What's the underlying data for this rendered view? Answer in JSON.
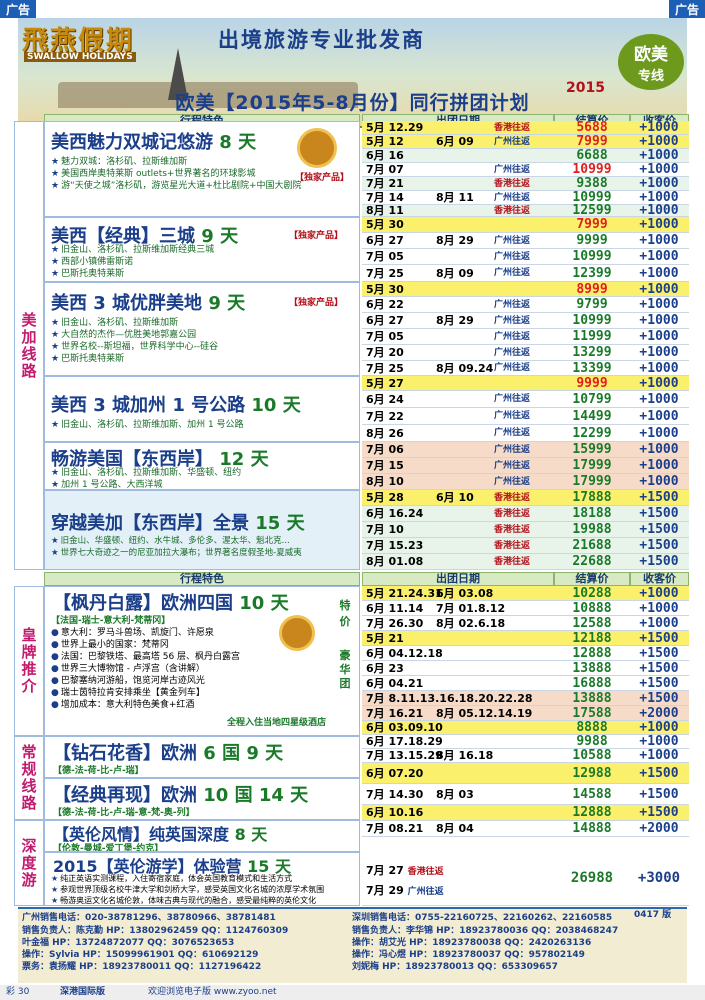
{
  "ad_label_left": "广告",
  "ad_label_right": "广告",
  "banner": {
    "logo_cn": "飛燕假期",
    "logo_en": "SWALLOW HOLIDAYS",
    "slogan": "出境旅游专业批发商",
    "badge_line1": "欧美",
    "badge_line2": "专线",
    "year": "2015",
    "main_title": "欧美【2015年5-8月份】同行拼团计划"
  },
  "headers": {
    "features": "行程特色",
    "dates": "出团日期",
    "settle": "结算价",
    "commission": "收客价"
  },
  "categories": {
    "us": "美加线路",
    "royal": "皇牌推介",
    "regular": "常规线路",
    "deep": "深度游"
  },
  "products": [
    {
      "title": "美西魅力双城记悠游",
      "days": "8 天",
      "excl": "【独家产品】",
      "features": [
        "魅力双城：洛杉矶、拉斯维加斯",
        "美国西岸奥特莱斯 outlets+世界著名的环球影城",
        "游“天使之城”洛杉矶，游览星光大道+杜比剧院+中国大剧院"
      ]
    },
    {
      "title": "美西【经典】三城",
      "days": "9 天",
      "excl": "【独家产品】",
      "features": [
        "旧金山、洛杉矶、拉斯维加斯经典三城",
        "西部小镇佛雷斯诺",
        "巴斯托奥特莱斯"
      ]
    },
    {
      "title": "美西 3 城优胖美地",
      "days": "9 天",
      "excl": "【独家产品】",
      "features": [
        "旧金山、洛杉矶、拉斯维加斯",
        "大自然的杰作—优胜美地郭嘉公园",
        "世界名校--斯坦福，世界科学中心--硅谷",
        "巴斯托奥特莱斯"
      ]
    },
    {
      "title": "美西 3 城加州 1 号公路",
      "days": "10 天",
      "excl": "",
      "features": [
        "旧金山、洛杉矶、拉斯维加斯、加州 1 号公路"
      ]
    },
    {
      "title": "畅游美国【东西岸】",
      "days": "12 天",
      "excl": "",
      "features": [
        "旧金山、洛杉矶、拉斯维加斯、华盛顿、纽约",
        "加州 1 号公路、大西洋城"
      ]
    },
    {
      "title": "穿越美加【东西岸】全景",
      "days": "15 天",
      "excl": "",
      "features": [
        "旧金山、华盛顿、纽约、水牛城、多伦多、渥太华、魁北克...",
        "世界七大奇迹之一的尼亚加拉大瀑布；世界著名度假圣地-夏威夷"
      ]
    },
    {
      "title": "【枫丹白露】欧洲四国",
      "days": "10 天",
      "sub": "【法国-瑞士-意大利-梵蒂冈】",
      "side1": "特价",
      "side2": "豪华团",
      "features": [
        "意大利：罗马斗兽场、凯旋门、许愿泉",
        "世界上最小的国家：梵蒂冈",
        "法国：巴黎铁塔、最高塔 56 层、枫丹白露宫",
        "世界三大博物馆 - 卢浮宫（含讲解）",
        "巴黎塞纳河游船，饱览河岸古迹风光",
        "瑞士茵特拉肯安排乘坐【黄金列车】",
        "增加成本：意大利特色美食+红酒"
      ],
      "note": "全程入住当地四星级酒店"
    },
    {
      "title": "【钻石花香】欧洲",
      "days": "6 国 9 天",
      "sub": "【德-法-荷-比-卢-瑞】"
    },
    {
      "title": "【经典再现】欧洲",
      "days": "10 国 14 天",
      "sub": "【德-法-荷-比-卢-瑞-意-梵-奥-列】"
    },
    {
      "title": "【英伦风情】纯英国深度",
      "days": "8 天",
      "sub": "【伦敦-曼城-爱丁堡-约克】"
    },
    {
      "title": "2015【英伦游学】体验营",
      "days": "15 天",
      "features": [
        "纯正英语实测课程，入住寄宿家庭，体会英国教育模式和生活方式",
        "参观世界顶级名校牛津大学和剑桥大学，感受英国文化名城的浓厚学术氛围",
        "畅游奥运文化名城伦敦，体味古典与现代的融合，感受最纯粹的英伦文化"
      ]
    }
  ],
  "rows": [
    {
      "d1": "5月 12.29",
      "d2": "",
      "tag": "香港往返",
      "price": "5688",
      "comm": "+1000",
      "bg": "y",
      "red": true
    },
    {
      "d1": "5月 12",
      "d2": "6月 09",
      "tag": "广州往返",
      "price": "7999",
      "comm": "+1000",
      "bg": "y",
      "red": true
    },
    {
      "d1": "6月 16",
      "d2": "",
      "tag": "",
      "price": "6688",
      "comm": "+1000",
      "bg": "g"
    },
    {
      "d1": "7月 07",
      "d2": "",
      "tag": "广州往返",
      "price": "10999",
      "comm": "+1000",
      "bg": "w",
      "red": true
    },
    {
      "d1": "7月 21",
      "d2": "",
      "tag": "香港往返",
      "price": "9388",
      "comm": "+1000",
      "bg": "g"
    },
    {
      "d1": "7月 14",
      "d2": "8月 11",
      "tag": "广州往返",
      "price": "10999",
      "comm": "+1000",
      "bg": "w"
    },
    {
      "d1": "8月 11",
      "d2": "",
      "tag": "香港往返",
      "price": "12599",
      "comm": "+1000",
      "bg": "g"
    },
    {
      "d1": "5月 30",
      "d2": "",
      "tag": "",
      "price": "7999",
      "comm": "+1000",
      "bg": "y",
      "red": true
    },
    {
      "d1": "6月 27",
      "d2": "8月 29",
      "tag": "广州往返",
      "price": "9999",
      "comm": "+1000",
      "bg": "w"
    },
    {
      "d1": "7月 05",
      "d2": "",
      "tag": "广州往返",
      "price": "10999",
      "comm": "+1000",
      "bg": "w"
    },
    {
      "d1": "7月 25",
      "d2": "8月 09",
      "tag": "广州往返",
      "price": "12399",
      "comm": "+1000",
      "bg": "w"
    },
    {
      "d1": "5月 30",
      "d2": "",
      "tag": "",
      "price": "8999",
      "comm": "+1000",
      "bg": "y",
      "red": true
    },
    {
      "d1": "6月 22",
      "d2": "",
      "tag": "广州往返",
      "price": "9799",
      "comm": "+1000",
      "bg": "w"
    },
    {
      "d1": "6月 27",
      "d2": "8月 29",
      "tag": "广州往返",
      "price": "10999",
      "comm": "+1000",
      "bg": "w"
    },
    {
      "d1": "7月 05",
      "d2": "",
      "tag": "广州往返",
      "price": "11999",
      "comm": "+1000",
      "bg": "w"
    },
    {
      "d1": "7月 20",
      "d2": "",
      "tag": "广州往返",
      "price": "13299",
      "comm": "+1000",
      "bg": "w"
    },
    {
      "d1": "7月 25",
      "d2": "8月 09.24",
      "tag": "广州往返",
      "price": "13399",
      "comm": "+1000",
      "bg": "w"
    },
    {
      "d1": "5月 27",
      "d2": "",
      "tag": "",
      "price": "9999",
      "comm": "+1000",
      "bg": "y",
      "red": true
    },
    {
      "d1": "6月 24",
      "d2": "",
      "tag": "广州往返",
      "price": "10799",
      "comm": "+1000",
      "bg": "w"
    },
    {
      "d1": "7月 22",
      "d2": "",
      "tag": "广州往返",
      "price": "14499",
      "comm": "+1000",
      "bg": "w"
    },
    {
      "d1": "8月 26",
      "d2": "",
      "tag": "广州往返",
      "price": "12299",
      "comm": "+1000",
      "bg": "w"
    },
    {
      "d1": "7月 06",
      "d2": "",
      "tag": "广州往返",
      "price": "15999",
      "comm": "+1000",
      "bg": "p"
    },
    {
      "d1": "7月 15",
      "d2": "",
      "tag": "广州往返",
      "price": "17999",
      "comm": "+1000",
      "bg": "p"
    },
    {
      "d1": "8月 10",
      "d2": "",
      "tag": "广州往返",
      "price": "17999",
      "comm": "+1000",
      "bg": "p"
    },
    {
      "d1": "5月 28",
      "d2": "6月 10",
      "tag": "香港往返",
      "price": "17888",
      "comm": "+1500",
      "bg": "y"
    },
    {
      "d1": "6月 16.24",
      "d2": "",
      "tag": "香港往返",
      "price": "18188",
      "comm": "+1500",
      "bg": "g"
    },
    {
      "d1": "7月 10",
      "d2": "",
      "tag": "香港往返",
      "price": "19988",
      "comm": "+1500",
      "bg": "g"
    },
    {
      "d1": "7月 15.23",
      "d2": "",
      "tag": "香港往返",
      "price": "21688",
      "comm": "+1500",
      "bg": "g"
    },
    {
      "d1": "8月 01.08",
      "d2": "",
      "tag": "香港往返",
      "price": "22688",
      "comm": "+1500",
      "bg": "g"
    }
  ],
  "euro_rows": [
    {
      "d1": "5月 21.24.31",
      "d2": "6月 03.08",
      "price": "10288",
      "comm": "+1000",
      "bg": "y"
    },
    {
      "d1": "6月 11.14",
      "d2": "7月 01.8.12",
      "price": "10888",
      "comm": "+1000",
      "bg": "w"
    },
    {
      "d1": "7月 26.30",
      "d2": "8月 02.6.18",
      "price": "12588",
      "comm": "+1000",
      "bg": "w"
    },
    {
      "d1": "5月 21",
      "d2": "",
      "price": "12188",
      "comm": "+1500",
      "bg": "y"
    },
    {
      "d1": "6月 04.12.18",
      "d2": "",
      "price": "12888",
      "comm": "+1500",
      "bg": "w"
    },
    {
      "d1": "6月 23",
      "d2": "",
      "price": "13888",
      "comm": "+1500",
      "bg": "w"
    },
    {
      "d1": "6月 04.21",
      "d2": "",
      "price": "16888",
      "comm": "+1500",
      "bg": "w"
    },
    {
      "d1": "7月 8.11.13.16.18.20.22.28",
      "d2": "",
      "price": "13888",
      "comm": "+1500",
      "bg": "p"
    },
    {
      "d1": "7月 16.21",
      "d2": "8月 05.12.14.19",
      "price": "17588",
      "comm": "+2000",
      "bg": "p"
    },
    {
      "d1": "6月 03.09.10",
      "d2": "",
      "price": "8888",
      "comm": "+1000",
      "bg": "y"
    },
    {
      "d1": "6月 17.18.29",
      "d2": "",
      "price": "9988",
      "comm": "+1000",
      "bg": "w"
    },
    {
      "d1": "7月 13.15.29",
      "d2": "8月 16.18",
      "price": "10588",
      "comm": "+1000",
      "bg": "w"
    },
    {
      "d1": "6月 07.20",
      "d2": "",
      "price": "12988",
      "comm": "+1500",
      "bg": "y"
    },
    {
      "d1": "7月 14.30",
      "d2": "8月 03",
      "price": "14588",
      "comm": "+1500",
      "bg": "w"
    },
    {
      "d1": "6月 10.16",
      "d2": "",
      "price": "12888",
      "comm": "+1500",
      "bg": "y"
    },
    {
      "d1": "7月 08.21",
      "d2": "8月 04",
      "price": "14888",
      "comm": "+2000",
      "bg": "w"
    }
  ],
  "study_rows": {
    "d1": "7月 27",
    "d1tag": "香港往返",
    "d2": "7月 29",
    "d2tag": "广州往返",
    "price": "26988",
    "comm": "+3000"
  },
  "footer": {
    "gz_tel": "广州销售电话：020-38781296、38780966、38781481",
    "sz_tel": "深圳销售电话：0755-22160725、22160262、22160585",
    "version": "0417 版",
    "gz_staff": [
      "销售负责人：陈克勤  HP：13802962459  QQ：1124760309",
      "叶金福  HP：13724872077  QQ：3076523653",
      "操作：Sylvia  HP：15099961901  QQ：610692129",
      "票务：袁扬耀  HP：18923780011  QQ：1127196422"
    ],
    "sz_staff": [
      "销售负责人：李华锦  HP：18923780036  QQ：2038468247",
      "操作：胡艾光  HP：18923780038  QQ：2420263136",
      "操作：冯心煜  HP：18923780037  QQ：957802149",
      "刘妮梅  HP：18923780013  QQ：653309657"
    ]
  },
  "bottom": {
    "page": "彩 30",
    "edition": "深港国际版",
    "site": "欢迎浏览电子版  www.zyoo.net"
  }
}
